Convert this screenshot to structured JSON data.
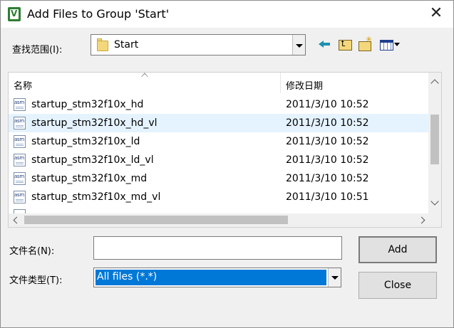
{
  "window": {
    "title": "Add Files to Group 'Start'",
    "close_glyph": "✕"
  },
  "lookin": {
    "label": "查找范围(I):",
    "value": "Start"
  },
  "toolbar": {
    "icons": [
      "back-icon",
      "up-folder-icon",
      "new-folder-icon",
      "view-menu-icon"
    ]
  },
  "filelist": {
    "columns": {
      "name": "名称",
      "date": "修改日期"
    },
    "icon_text": "asm",
    "files": [
      {
        "name": "startup_stm32f10x_hd",
        "date": "2011/3/10 10:52"
      },
      {
        "name": "startup_stm32f10x_hd_vl",
        "date": "2011/3/10 10:52"
      },
      {
        "name": "startup_stm32f10x_ld",
        "date": "2011/3/10 10:52"
      },
      {
        "name": "startup_stm32f10x_ld_vl",
        "date": "2011/3/10 10:52"
      },
      {
        "name": "startup_stm32f10x_md",
        "date": "2011/3/10 10:52"
      },
      {
        "name": "startup_stm32f10x_md_vl",
        "date": "2011/3/10 10:51"
      }
    ]
  },
  "filename": {
    "label": "文件名(N):",
    "value": "",
    "placeholder": ""
  },
  "filetype": {
    "label": "文件类型(T):",
    "value": "All files (*.*)"
  },
  "buttons": {
    "add": "Add",
    "close": "Close"
  },
  "colors": {
    "selection": "#0078d7",
    "hover_row": "#e5f3ff",
    "window_bg": "#f0f0f0"
  }
}
